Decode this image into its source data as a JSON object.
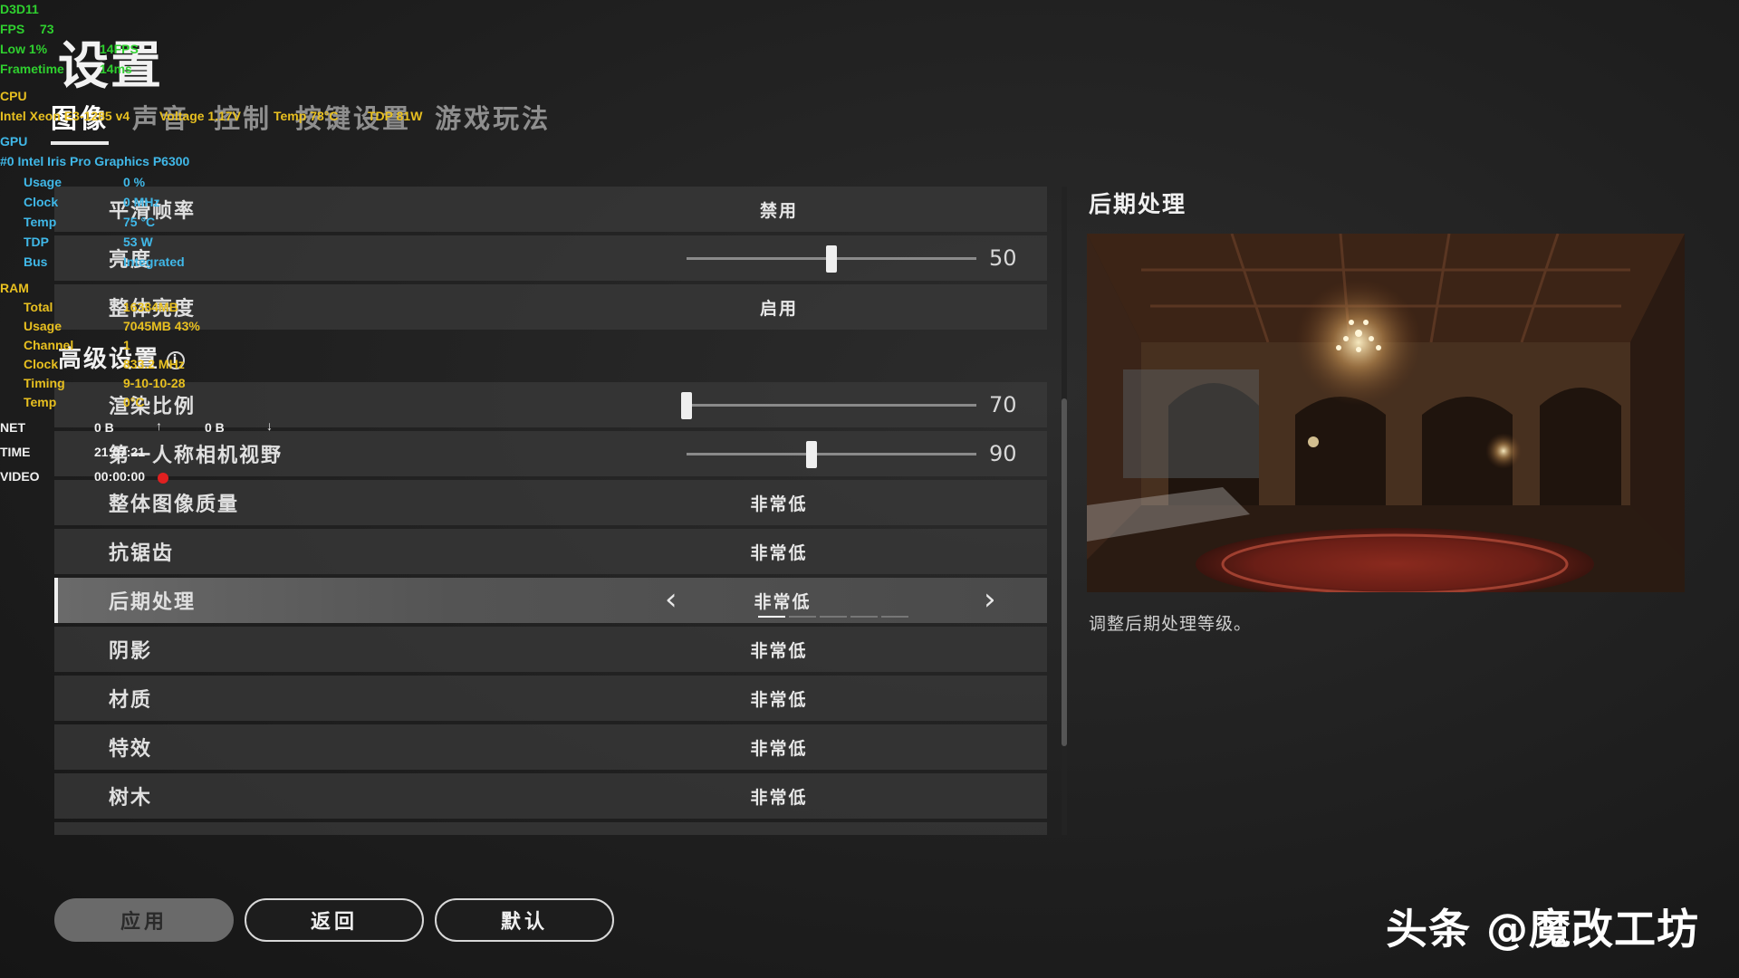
{
  "header": {
    "title": "设置",
    "tabs": [
      "图像",
      "声音",
      "控制",
      "按键设置",
      "游戏玩法"
    ],
    "active_tab": 0
  },
  "settings": {
    "smooth_fps": {
      "label": "平滑帧率",
      "value": "禁用"
    },
    "brightness": {
      "label": "亮度",
      "value": "50",
      "fraction": 0.5
    },
    "overall_brightness": {
      "label": "整体亮度",
      "value": "启用"
    },
    "advanced_section": {
      "title": "高级设置",
      "info_icon": "info-circle-icon"
    },
    "render_scale": {
      "label": "渲染比例",
      "value": "70",
      "fraction": 0.0
    },
    "camera_fov": {
      "label": "第一人称相机视野",
      "value": "90",
      "fraction": 0.43
    },
    "rows": [
      {
        "label": "整体图像质量",
        "value": "非常低"
      },
      {
        "label": "抗锯齿",
        "value": "非常低"
      },
      {
        "label": "后期处理",
        "value": "非常低",
        "selected": true,
        "level_index": 0,
        "level_count": 5
      },
      {
        "label": "阴影",
        "value": "非常低"
      },
      {
        "label": "材质",
        "value": "非常低"
      },
      {
        "label": "特效",
        "value": "非常低"
      },
      {
        "label": "树木",
        "value": "非常低"
      }
    ]
  },
  "preview": {
    "title": "后期处理",
    "description": "调整后期处理等级。"
  },
  "buttons": {
    "apply": "应用",
    "back": "返回",
    "default": "默认"
  },
  "watermark": "头条 @魔改工坊",
  "overlay": {
    "api": "D3D11",
    "fps_label": "FPS",
    "fps": "73",
    "low_label": "Low 1%",
    "low": "14FPS",
    "frametime_label": "Frametime",
    "frametime": "14ms",
    "cpu_label": "CPU",
    "cpu_line": "Intel Xeon E3-1285 v4",
    "voltage": "Voltage  1.17V",
    "cpu_temp": "Temp  78°C",
    "cpu_tdp": "TDP  81W",
    "gpu_label": "GPU",
    "gpu_name": "#0 Intel Iris Pro Graphics P6300",
    "gpu_rows": [
      {
        "k": "Usage",
        "v": "0 %"
      },
      {
        "k": "Clock",
        "v": "0 MHz"
      },
      {
        "k": "Temp",
        "v": "75 °C"
      },
      {
        "k": "TDP",
        "v": "53 W"
      },
      {
        "k": "Bus",
        "v": "Integrated"
      }
    ],
    "ram_label": "RAM",
    "ram_rows": [
      {
        "k": "Total",
        "v": "16384MB"
      },
      {
        "k": "Usage",
        "v": "7045MB     43%"
      },
      {
        "k": "Channel",
        "v": "1"
      },
      {
        "k": "Clock",
        "v": "833.2 MHz"
      },
      {
        "k": "Timing",
        "v": "9-10-10-28"
      },
      {
        "k": "Temp",
        "v": "0°C"
      }
    ],
    "net_label": "NET",
    "net_up": "0 B",
    "net_down": "0 B",
    "time_label": "TIME",
    "time": "21:07:21",
    "video_label": "VIDEO",
    "video": "00:00:00"
  }
}
